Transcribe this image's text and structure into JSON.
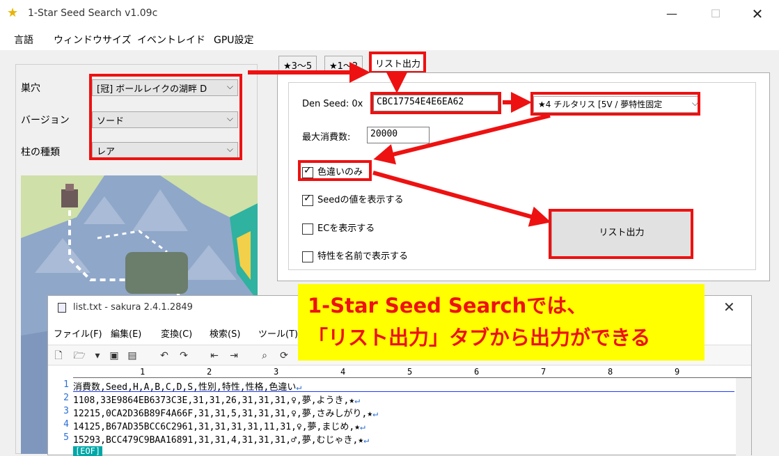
{
  "window": {
    "title": "1-Star Seed Search v1.09c",
    "minimize": "—",
    "maximize": "☐",
    "close": "✕"
  },
  "menu": [
    "言語",
    "ウィンドウサイズ",
    "イベントレイド",
    "GPU設定"
  ],
  "left": {
    "den_label": "巣穴",
    "den_value": "[冠] ボールレイクの湖畔 D",
    "version_label": "バージョン",
    "version_value": "ソード",
    "pillar_label": "柱の種類",
    "pillar_value": "レア"
  },
  "tabs": [
    "★3～5",
    "★1～2",
    "リスト出力"
  ],
  "form": {
    "den_seed_label": "Den Seed: 0x",
    "den_seed_value": "CBC17754E4E6EA62",
    "pokemon_value": "★4 チルタリス [5V / 夢特性固定",
    "max_consume_label": "最大消費数:",
    "max_consume_value": "20000",
    "checks": [
      {
        "label": "色違いのみ",
        "checked": true
      },
      {
        "label": "Seedの値を表示する",
        "checked": true
      },
      {
        "label": "ECを表示する",
        "checked": false
      },
      {
        "label": "特性を名前で表示する",
        "checked": false
      }
    ],
    "output_button": "リスト出力"
  },
  "caption": {
    "line1": "1-Star Seed Searchでは、",
    "line2": "「リスト出力」タブから出力ができる"
  },
  "editor": {
    "title": "list.txt - sakura 2.4.1.2849",
    "close": "✕",
    "menu": [
      "ファイル(F)",
      "編集(E)",
      "変換(C)",
      "検索(S)",
      "ツール(T)"
    ],
    "ruler": [
      "1",
      "2",
      "3",
      "4",
      "5",
      "6",
      "7",
      "8",
      "9"
    ],
    "line_numbers": [
      "1",
      "2",
      "3",
      "4",
      "5"
    ],
    "lines": [
      "消費数,Seed,H,A,B,C,D,S,性別,特性,性格,色違い",
      "1108,33E9864EB6373C3E,31,31,26,31,31,31,♀,夢,ようき,★",
      "12215,0CA2D36B89F4A66F,31,31,5,31,31,31,♀,夢,さみしがり,★",
      "14125,B67AD35BCC6C2961,31,31,31,31,11,31,♀,夢,まじめ,★",
      "15293,BCC479C9BAA16891,31,31,4,31,31,31,♂,夢,むじゃき,★"
    ],
    "newline_mark": "↵",
    "eof": "[EOF]"
  },
  "colors": {
    "annotation_red": "#ee1111",
    "caption_bg": "#ffff00"
  }
}
